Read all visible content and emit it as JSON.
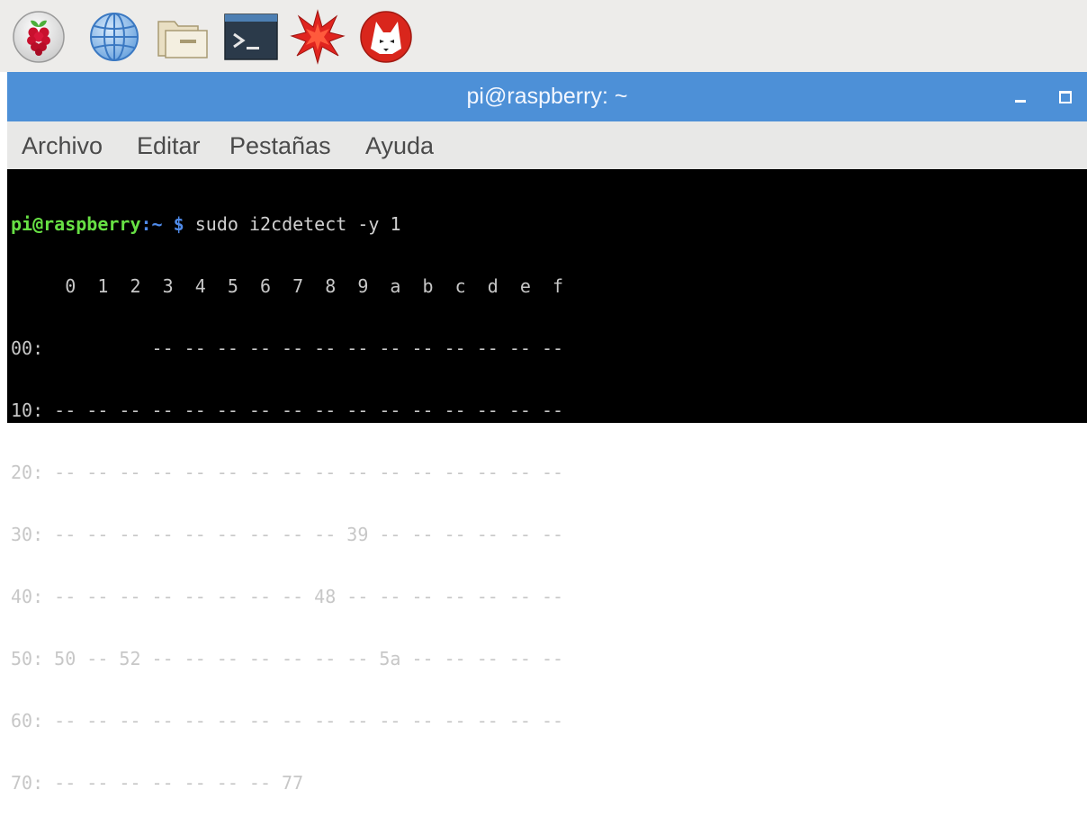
{
  "taskbar": {
    "launchers": [
      {
        "icon": "raspberry-menu-icon"
      },
      {
        "icon": "web-browser-globe-icon"
      },
      {
        "icon": "file-manager-folder-icon"
      },
      {
        "icon": "terminal-icon"
      },
      {
        "icon": "mathematica-icon"
      },
      {
        "icon": "wolfram-icon"
      }
    ]
  },
  "window": {
    "title": "pi@raspberry: ~",
    "controls": {
      "minimize": "minimize-icon",
      "maximize": "maximize-icon"
    },
    "menu": [
      "Archivo",
      "Editar",
      "Pestañas",
      "Ayuda"
    ]
  },
  "terminal": {
    "prompt": {
      "user": "pi@raspberry",
      "path": ":~",
      "dollar": "$"
    },
    "command": "sudo i2cdetect -y 1",
    "output_lines": [
      "     0  1  2  3  4  5  6  7  8  9  a  b  c  d  e  f",
      "00:          -- -- -- -- -- -- -- -- -- -- -- -- --",
      "10: -- -- -- -- -- -- -- -- -- -- -- -- -- -- -- --",
      "20: -- -- -- -- -- -- -- -- -- -- -- -- -- -- -- --",
      "30: -- -- -- -- -- -- -- -- -- 39 -- -- -- -- -- --",
      "40: -- -- -- -- -- -- -- -- 48 -- -- -- -- -- -- --",
      "50: 50 -- 52 -- -- -- -- -- -- -- 5a -- -- -- -- --",
      "60: -- -- -- -- -- -- -- -- -- -- -- -- -- -- -- --",
      "70: -- -- -- -- -- -- -- 77"
    ]
  },
  "colors": {
    "titlebar": "#4d90d7",
    "terminal_bg": "#000000",
    "terminal_text": "#c7c7c7",
    "prompt_user": "#67e044",
    "prompt_path": "#4f8bea"
  }
}
